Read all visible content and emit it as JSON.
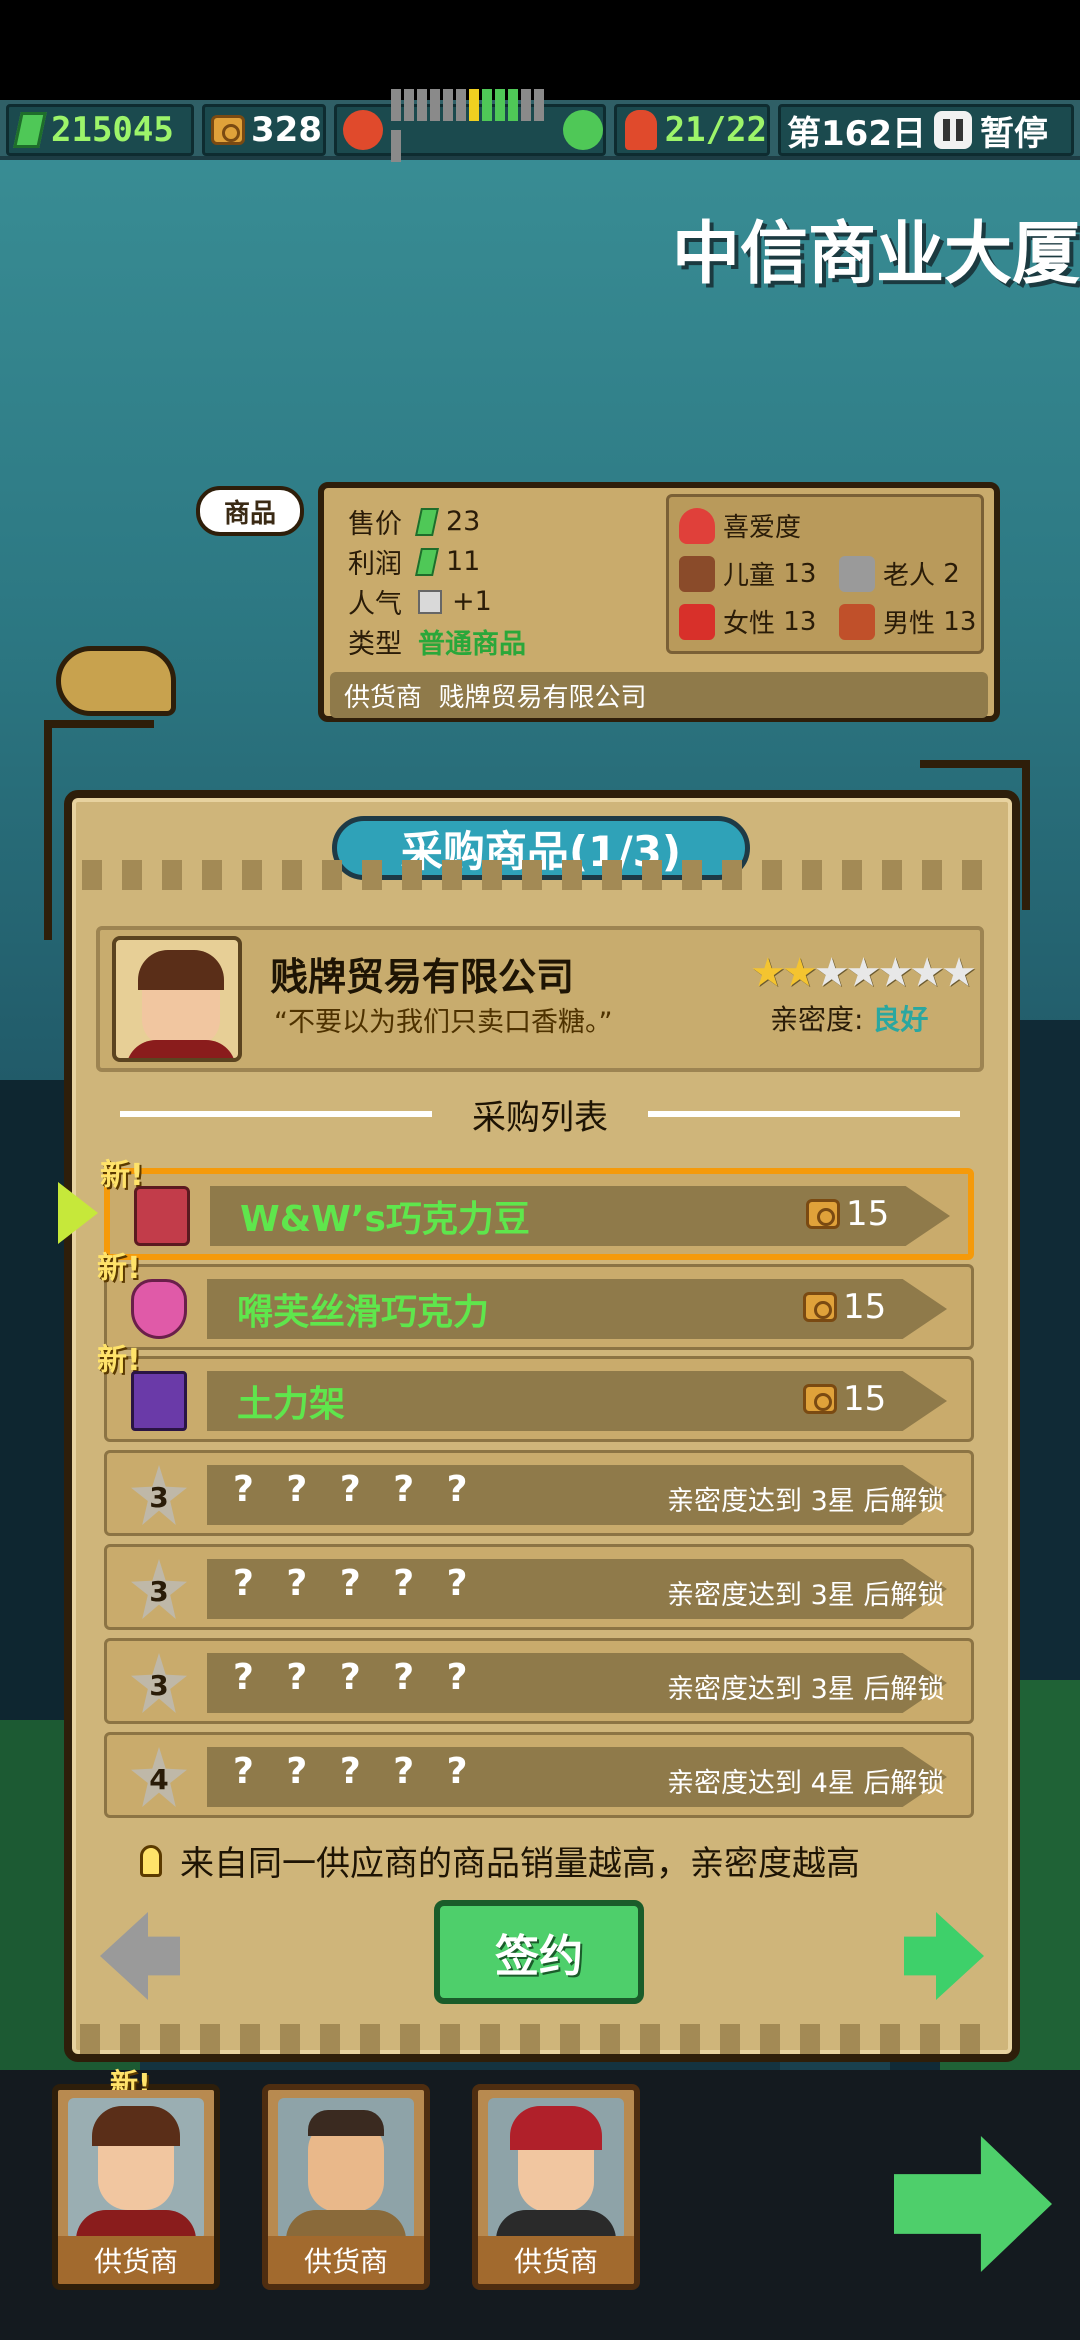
{
  "hud": {
    "money": "215045",
    "gems": "328",
    "customers": "21/22",
    "day": "第162日",
    "pause_label": "暂停",
    "mood_level": 0.5
  },
  "building_name": "中信商业大厦",
  "product_info": {
    "tag": "商品",
    "price_label": "售价",
    "price": "23",
    "profit_label": "利润",
    "profit": "11",
    "popularity_label": "人气",
    "popularity": "+1",
    "type_label": "类型",
    "type": "普通商品",
    "supplier_label": "供货商",
    "supplier": "贱牌贸易有限公司",
    "favor_title": "喜爱度",
    "favor": [
      {
        "label": "儿童",
        "value": "13"
      },
      {
        "label": "老人",
        "value": "2"
      },
      {
        "label": "女性",
        "value": "13"
      },
      {
        "label": "男性",
        "value": "13"
      }
    ]
  },
  "panel": {
    "title": "采购商品(1/3)",
    "company": "贱牌贸易有限公司",
    "quote": "“不要以为我们只卖口香糖。”",
    "stars_filled": 2,
    "stars_total": 7,
    "intimacy_label": "亲密度:",
    "intimacy_value": "良好",
    "list_title": "采购列表",
    "new_label": "新!",
    "items": [
      {
        "name": "W&W’s巧克力豆",
        "price": "15",
        "new": true,
        "selected": true
      },
      {
        "name": "嘚芙丝滑巧克力",
        "price": "15",
        "new": true,
        "selected": false
      },
      {
        "name": "土力架",
        "price": "15",
        "new": true,
        "selected": false
      }
    ],
    "locked": [
      {
        "name": "? ? ? ? ?",
        "star": "3",
        "hint": "亲密度达到 3星 后解锁"
      },
      {
        "name": "? ? ? ? ?",
        "star": "3",
        "hint": "亲密度达到 3星 后解锁"
      },
      {
        "name": "? ? ? ? ?",
        "star": "3",
        "hint": "亲密度达到 3星 后解锁"
      },
      {
        "name": "? ? ? ? ?",
        "star": "4",
        "hint": "亲密度达到 4星 后解锁"
      }
    ],
    "tip": "来自同一供应商的商品销量越高，亲密度越高",
    "sign_label": "签约"
  },
  "suppliers": [
    {
      "label": "供货商",
      "new_badge": "新!"
    },
    {
      "label": "供货商"
    },
    {
      "label": "供货商"
    }
  ],
  "colors": {
    "accent_teal": "#2fa2b8",
    "green": "#4ecf6b",
    "gold": "#cfb57a",
    "selected_border": "#f59a0a"
  }
}
